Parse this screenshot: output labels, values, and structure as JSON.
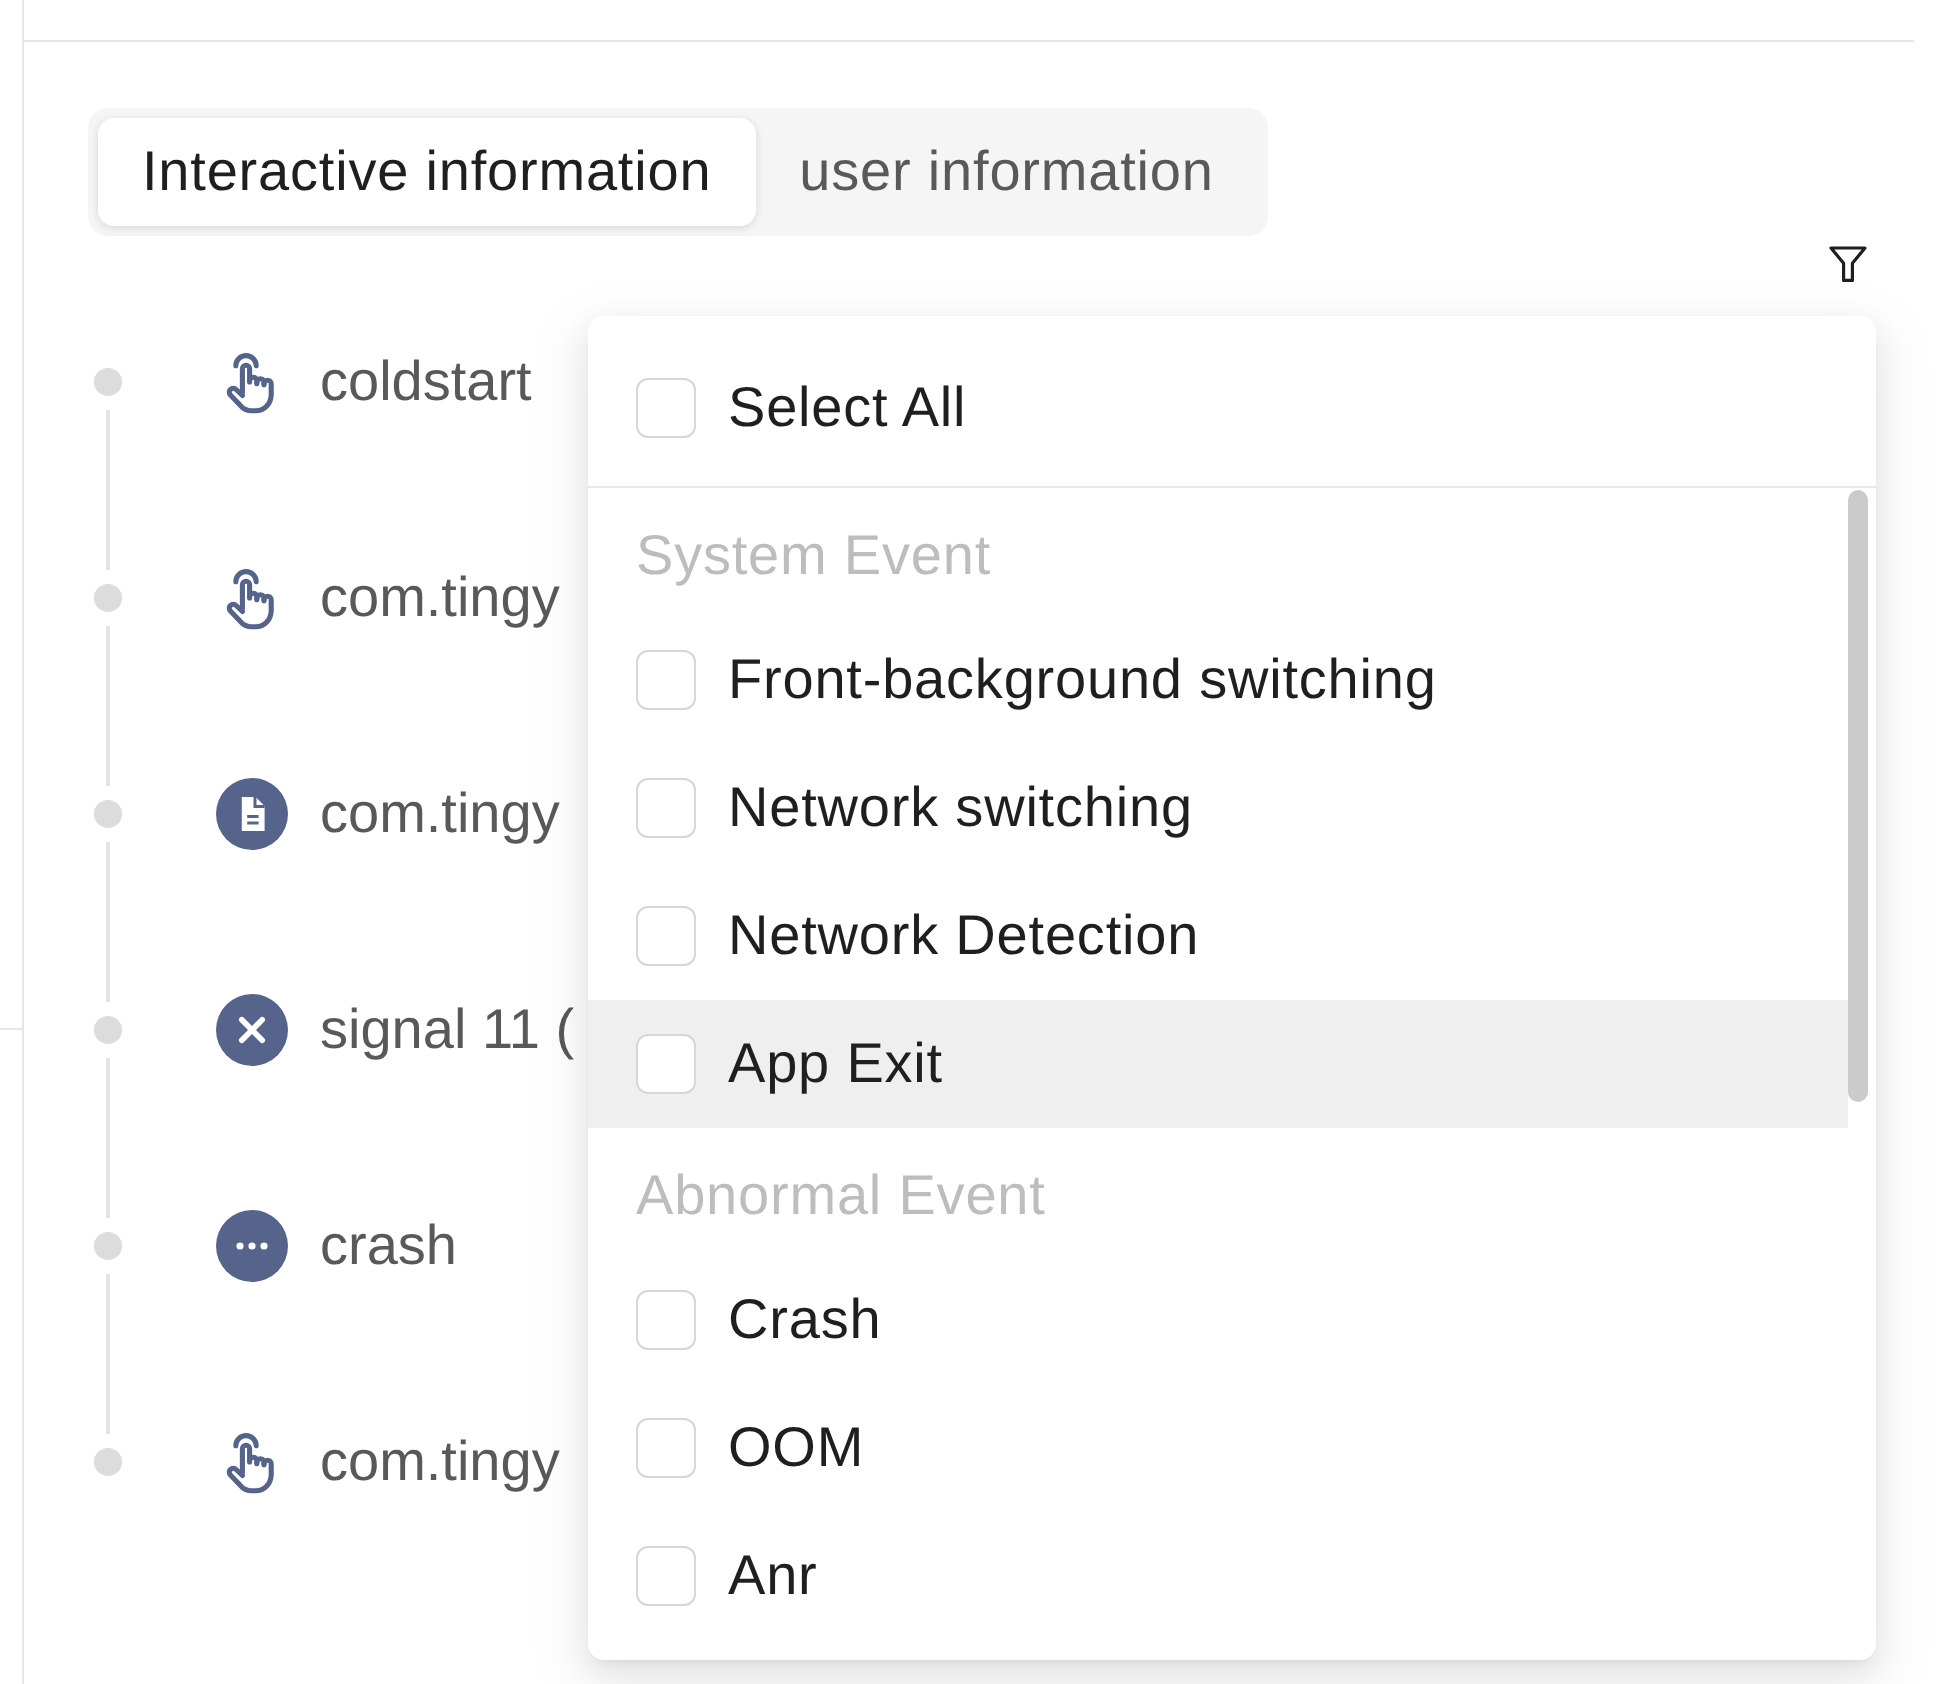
{
  "tabs": [
    {
      "label": "Interactive information",
      "selected": true
    },
    {
      "label": "user information",
      "selected": false
    }
  ],
  "timeline": [
    {
      "kind": "tap",
      "text": "coldstart"
    },
    {
      "kind": "tap",
      "text": "com.tingy"
    },
    {
      "kind": "document",
      "text": "com.tingy"
    },
    {
      "kind": "error",
      "text": "signal 11 ("
    },
    {
      "kind": "more",
      "text": "crash"
    },
    {
      "kind": "tap",
      "text": "com.tingy"
    }
  ],
  "filter_menu": {
    "select_all": {
      "label": "Select All",
      "checked": false
    },
    "groups": [
      {
        "title": "System Event",
        "options": [
          {
            "label": "Front-background switching",
            "checked": false,
            "highlighted": false
          },
          {
            "label": "Network switching",
            "checked": false,
            "highlighted": false
          },
          {
            "label": "Network Detection",
            "checked": false,
            "highlighted": false
          },
          {
            "label": "App Exit",
            "checked": false,
            "highlighted": true
          }
        ]
      },
      {
        "title": "Abnormal Event",
        "options": [
          {
            "label": "Crash",
            "checked": false,
            "highlighted": false
          },
          {
            "label": "OOM",
            "checked": false,
            "highlighted": false
          },
          {
            "label": "Anr",
            "checked": false,
            "highlighted": false
          }
        ]
      }
    ]
  }
}
